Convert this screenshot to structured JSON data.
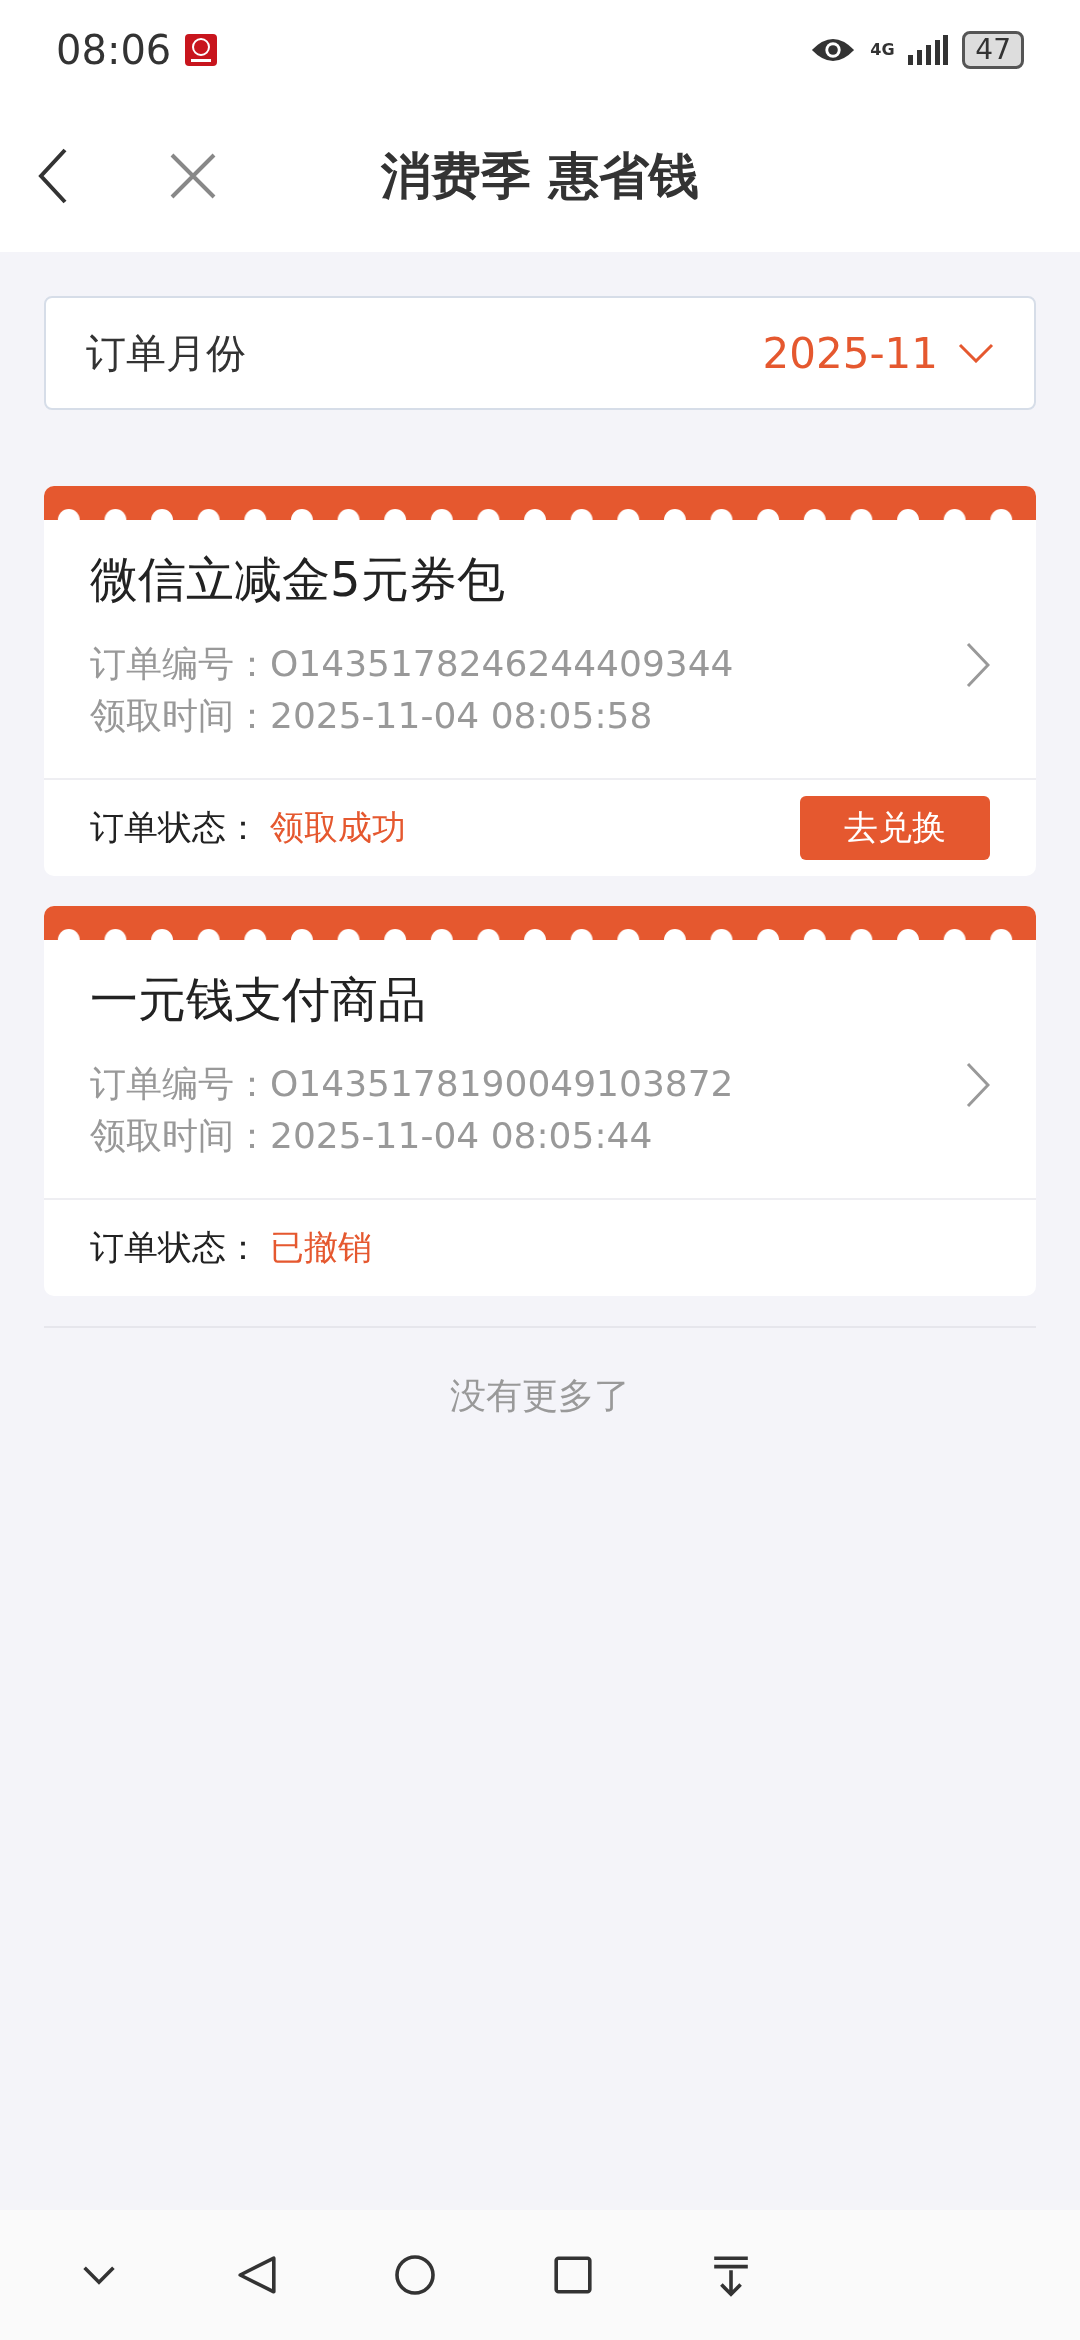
{
  "status_bar": {
    "time": "08:06",
    "battery": "47",
    "network": "4G"
  },
  "header": {
    "title": "消费季 惠省钱"
  },
  "month_filter": {
    "label": "订单月份",
    "value": "2025-11"
  },
  "orders": [
    {
      "title": "微信立减金5元券包",
      "number_label": "订单编号：",
      "number": "O1435178246244409344",
      "time_label": "领取时间：",
      "time": "2025-11-04 08:05:58",
      "status_label": "订单状态：",
      "status": "领取成功",
      "action": "去兑换"
    },
    {
      "title": "一元钱支付商品",
      "number_label": "订单编号：",
      "number": "O1435178190049103872",
      "time_label": "领取时间：",
      "time": "2025-11-04 08:05:44",
      "status_label": "订单状态：",
      "status": "已撤销"
    }
  ],
  "footer_note": "没有更多了"
}
